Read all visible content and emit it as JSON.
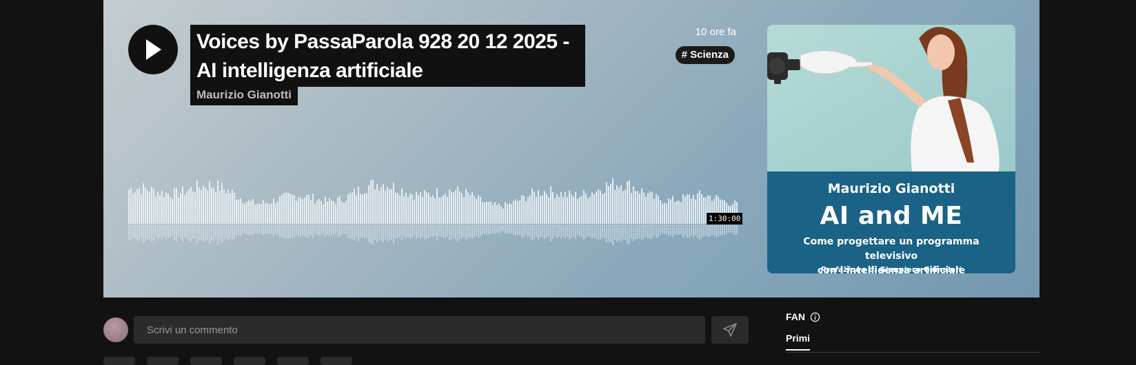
{
  "episode": {
    "title": "Voices by PassaParola 928 20 12 2025 - AI intelligenza artificiale",
    "author": "Maurizio Gianotti",
    "time_ago": "10 ore fa",
    "tag": "# Scienza",
    "duration": "1:30:00",
    "progress": 0
  },
  "cover": {
    "author": "Maurizio Gianotti",
    "title": "AI and ME",
    "subtitle_line1": "Come progettare un programma televisivo",
    "subtitle_line2": "con l'intelligenza artificiale",
    "preface_label": "Prefazione di",
    "preface_name": "Gianpiero Gamaleri"
  },
  "comment": {
    "placeholder": "Scrivi un commento"
  },
  "fan": {
    "label": "FAN",
    "tab": "Primi"
  },
  "icons": {
    "play": "play-icon",
    "send": "send-icon",
    "info": "info-icon"
  }
}
